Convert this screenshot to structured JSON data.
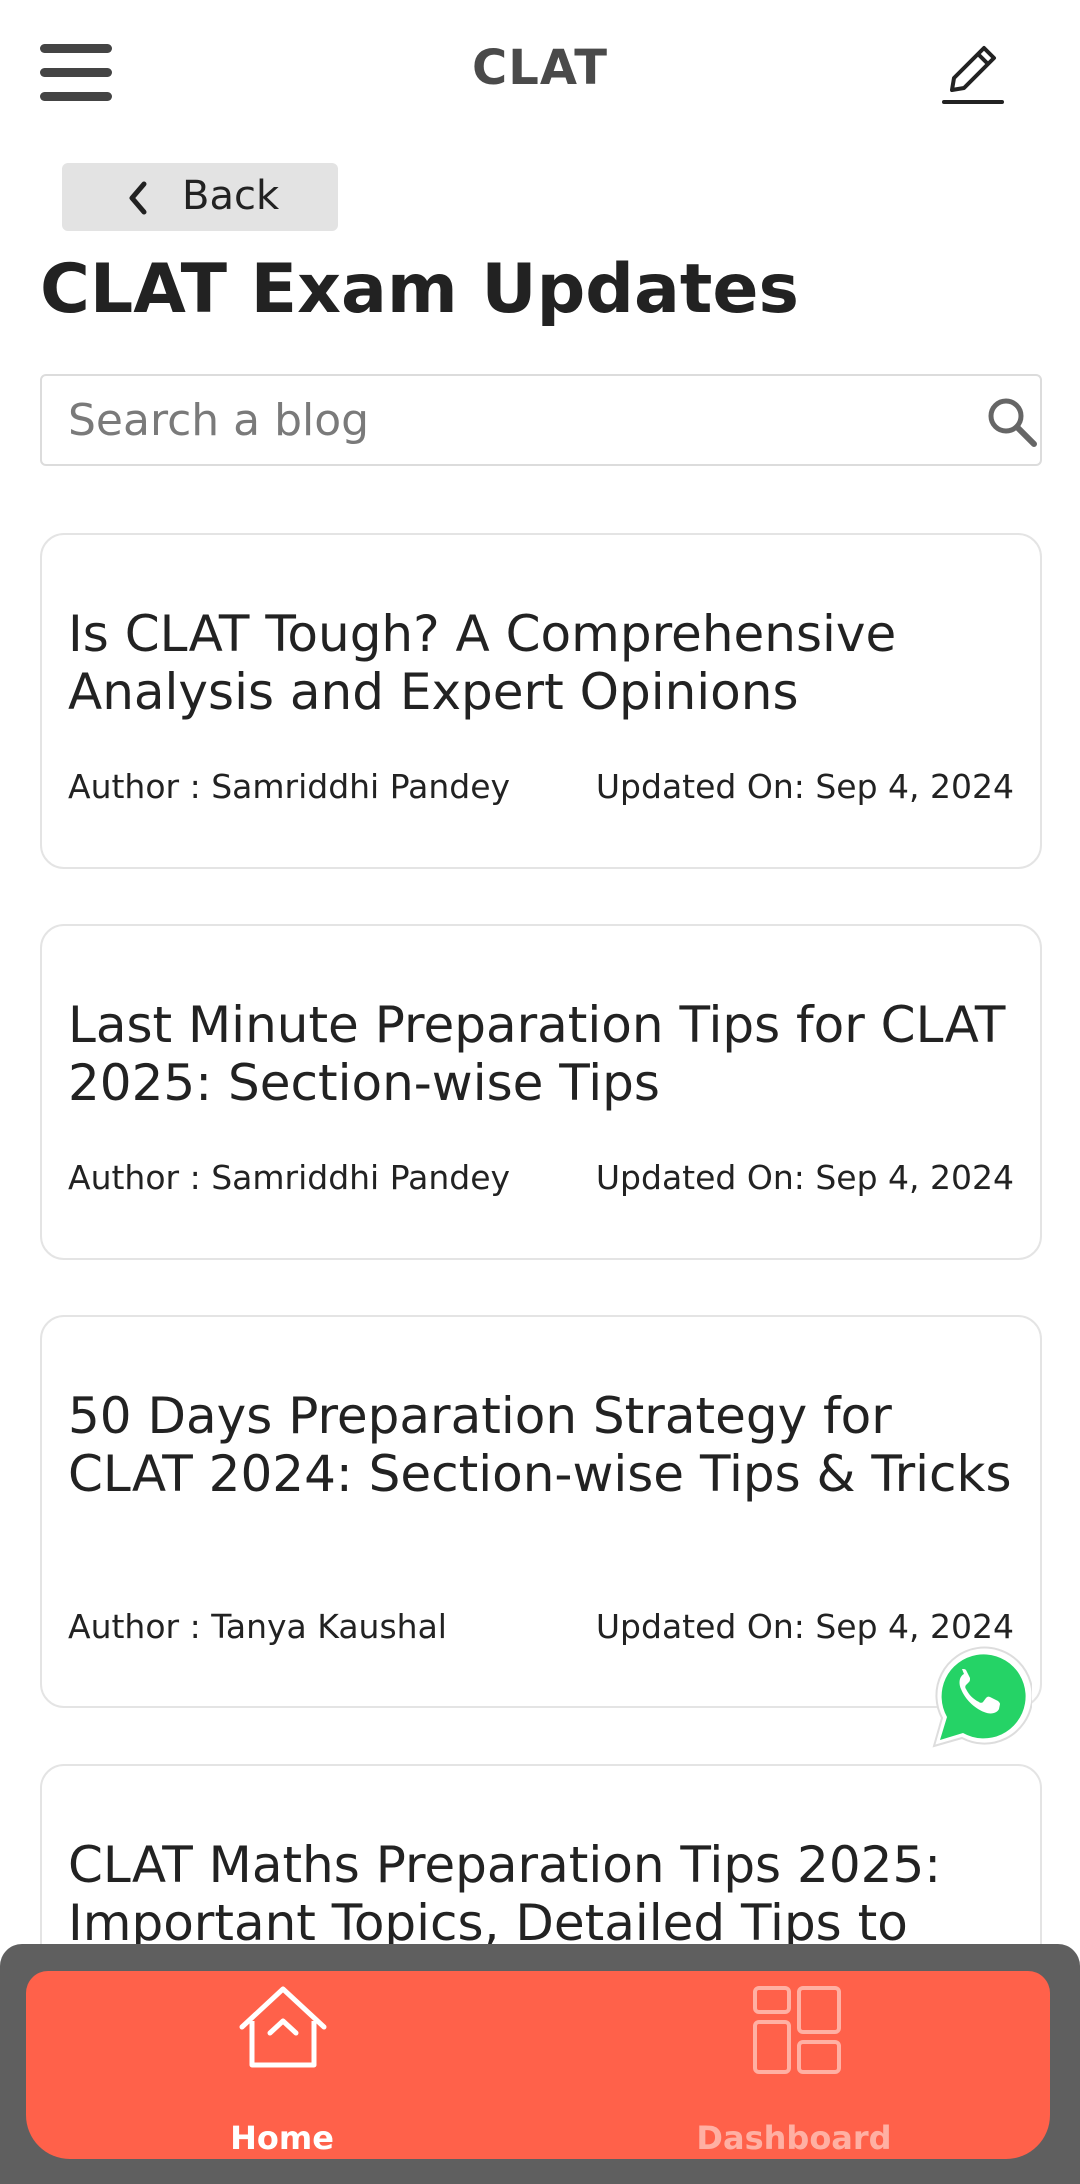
{
  "header": {
    "title": "CLAT",
    "menu_icon": "hamburger-menu-icon",
    "edit_icon": "pencil-edit-icon"
  },
  "back": {
    "label": "Back",
    "icon": "chevron-left-icon"
  },
  "page_title": "CLAT Exam Updates",
  "search": {
    "placeholder": "Search a blog",
    "value": "",
    "icon": "search-icon"
  },
  "posts": [
    {
      "title": "Is CLAT Tough? A Comprehensive Analysis and Expert Opinions",
      "author": "Author : Samriddhi Pandey",
      "updated": "Updated On: Sep 4, 2024"
    },
    {
      "title": "Last Minute Preparation Tips for CLAT 2025: Section-wise Tips",
      "author": "Author : Samriddhi Pandey",
      "updated": "Updated On: Sep 4, 2024"
    },
    {
      "title": "50 Days Preparation Strategy for CLAT 2024: Section-wise Tips & Tricks",
      "author": "Author : Tanya Kaushal",
      "updated": "Updated On: Sep 4, 2024"
    },
    {
      "title": "CLAT Maths Preparation Tips 2025: Important Topics, Detailed Tips to",
      "author": "",
      "updated": ""
    }
  ],
  "bottom_nav": {
    "home": "Home",
    "dashboard": "Dashboard",
    "home_icon": "house-icon",
    "dashboard_icon": "dashboard-grid-icon"
  },
  "colors": {
    "accent": "#ff614a",
    "nav_frame": "#5f5f5f",
    "whatsapp": "#25d366"
  }
}
